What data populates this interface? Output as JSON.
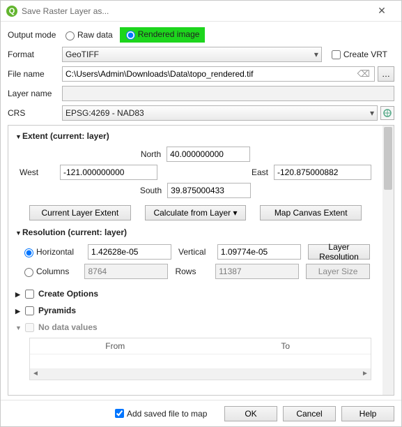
{
  "window": {
    "title": "Save Raster Layer as..."
  },
  "output_mode": {
    "label": "Output mode",
    "raw": "Raw data",
    "rendered": "Rendered image",
    "selected": "rendered"
  },
  "format": {
    "label": "Format",
    "value": "GeoTIFF",
    "create_vrt": "Create VRT"
  },
  "file_name": {
    "label": "File name",
    "value": "C:\\Users\\Admin\\Downloads\\Data\\topo_rendered.tif"
  },
  "layer_name": {
    "label": "Layer name",
    "value": ""
  },
  "crs": {
    "label": "CRS",
    "value": "EPSG:4269 - NAD83"
  },
  "extent": {
    "title": "Extent (current: layer)",
    "north_label": "North",
    "north": "40.000000000",
    "west_label": "West",
    "west": "-121.000000000",
    "east_label": "East",
    "east": "-120.875000882",
    "south_label": "South",
    "south": "39.875000433",
    "btn_current": "Current Layer Extent",
    "btn_calc": "Calculate from Layer ▾",
    "btn_canvas": "Map Canvas Extent"
  },
  "resolution": {
    "title": "Resolution (current: layer)",
    "mode_horizontal": "Horizontal",
    "horizontal": "1.42628e-05",
    "vertical_label": "Vertical",
    "vertical": "1.09774e-05",
    "btn_layer_res": "Layer Resolution",
    "mode_columns": "Columns",
    "columns": "8764",
    "rows_label": "Rows",
    "rows": "11387",
    "btn_layer_size": "Layer Size"
  },
  "create_options": {
    "title": "Create Options"
  },
  "pyramids": {
    "title": "Pyramids"
  },
  "nodata": {
    "title": "No data values",
    "col_from": "From",
    "col_to": "To"
  },
  "footer": {
    "add_to_map": "Add saved file to map",
    "ok": "OK",
    "cancel": "Cancel",
    "help": "Help"
  }
}
